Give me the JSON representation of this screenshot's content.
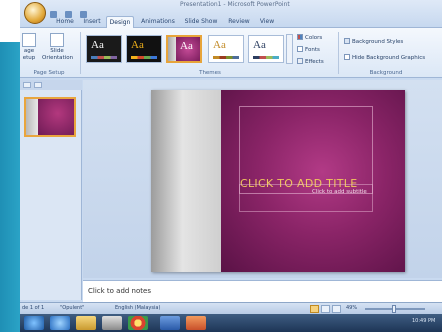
{
  "window": {
    "title": "Presentation1 - Microsoft PowerPoint"
  },
  "ribbon_tabs": [
    {
      "label": "Home",
      "active": false
    },
    {
      "label": "Insert",
      "active": false
    },
    {
      "label": "Design",
      "active": true
    },
    {
      "label": "Animations",
      "active": false
    },
    {
      "label": "Slide Show",
      "active": false
    },
    {
      "label": "Review",
      "active": false
    },
    {
      "label": "View",
      "active": false
    }
  ],
  "page_setup_group": {
    "label": "Page Setup",
    "page_setup_label": "age etup",
    "orientation_label": "Slide Orientation"
  },
  "themes_group": {
    "label": "Themes",
    "thumbnails": [
      {
        "text": "Aa",
        "bg": "#1a1a1a",
        "fg": "#ffffff"
      },
      {
        "text": "Aa",
        "bg": "#111111",
        "fg": "#f2b21b"
      },
      {
        "text": "Aa",
        "bg": "#ffffff",
        "fg": "#8a1f67"
      },
      {
        "text": "Aa",
        "bg": "#ffffff",
        "fg": "#c28a25"
      },
      {
        "text": "Aa",
        "bg": "#ffffff",
        "fg": "#2c3e60"
      }
    ],
    "colors_label": "Colors",
    "fonts_label": "Fonts",
    "effects_label": "Effects"
  },
  "background_group": {
    "label": "Background",
    "background_styles_label": "Background Styles",
    "hide_graphics_label": "Hide Background Graphics"
  },
  "slide": {
    "title_placeholder": "CLICK TO ADD TITLE",
    "subtitle_placeholder": "Click to add subtitle"
  },
  "notes": {
    "placeholder": "Click to add notes"
  },
  "status": {
    "slide_counter": "de 1 of 1",
    "theme_name": "\"Opulent\"",
    "language": "English (Malaysia)",
    "zoom": "49%"
  },
  "taskbar": {
    "clock": "10:49 PM"
  },
  "colors": {
    "accent_orange": "#e7a43a",
    "slide_purple": "#8a2467",
    "title_gold": "#f0c75d"
  }
}
